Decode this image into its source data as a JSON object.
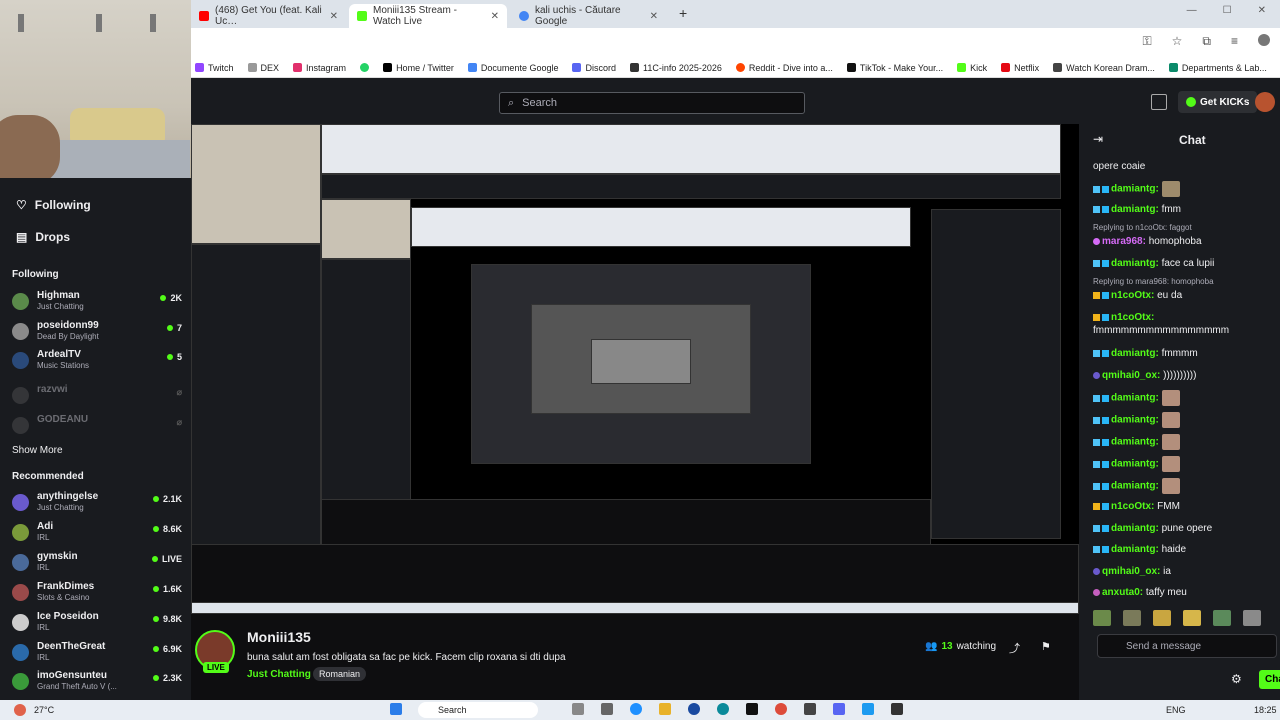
{
  "browser": {
    "tabs": [
      {
        "label": "(468) Get You (feat. Kali Uc…",
        "color": "#ff0000"
      },
      {
        "label": "Moniii135 Stream - Watch Live",
        "color": "#53fc18"
      },
      {
        "label": "kali uchis - Căutare Google",
        "color": "#4285f4"
      }
    ],
    "new_tab": "+",
    "bookmarks": [
      {
        "label": "Twitch",
        "color": "#9146ff"
      },
      {
        "label": "DEX",
        "color": "#999999"
      },
      {
        "label": "Instagram",
        "color": "#e1306c"
      },
      {
        "label": "",
        "color": "#25d366"
      },
      {
        "label": "Home / Twitter",
        "color": "#000000"
      },
      {
        "label": "Documente Google",
        "color": "#4285f4"
      },
      {
        "label": "Discord",
        "color": "#5865f2"
      },
      {
        "label": "11C-info 2025-2026",
        "color": "#333333"
      },
      {
        "label": "Reddit - Dive into a...",
        "color": "#ff4500"
      },
      {
        "label": "TikTok - Make Your...",
        "color": "#111111"
      },
      {
        "label": "Kick",
        "color": "#53fc18"
      },
      {
        "label": "Netflix",
        "color": "#e50914"
      },
      {
        "label": "Watch Korean Dram...",
        "color": "#444444"
      },
      {
        "label": "Departments & Lab...",
        "color": "#0b8a6a"
      }
    ]
  },
  "topnav": {
    "search_placeholder": "Search",
    "get_kicks": "Get KICKs"
  },
  "sidebar": {
    "following_nav": "Following",
    "drops_nav": "Drops",
    "following_header": "Following",
    "following": [
      {
        "name": "Highman",
        "category": "Just Chatting",
        "count": "2K",
        "live": true,
        "color": "#5a8a4a"
      },
      {
        "name": "poseidonn99",
        "category": "Dead By Daylight",
        "count": "7",
        "live": true,
        "color": "#8a8a8a"
      },
      {
        "name": "ArdealTV",
        "category": "Music Stations",
        "count": "5",
        "live": true,
        "color": "#2a4a7a"
      },
      {
        "name": "razvwi",
        "category": "",
        "count": "",
        "live": false,
        "color": "#666666"
      },
      {
        "name": "GODEANU",
        "category": "",
        "count": "",
        "live": false,
        "color": "#666666"
      }
    ],
    "show_more": "Show More",
    "recommended_header": "Recommended",
    "recommended": [
      {
        "name": "anythingelse",
        "category": "Just Chatting",
        "count": "2.1K",
        "color": "#6a5acd"
      },
      {
        "name": "Adi",
        "category": "IRL",
        "count": "8.6K",
        "color": "#7a9a3a"
      },
      {
        "name": "gymskin",
        "category": "IRL",
        "count": "LIVE",
        "color": "#4a6a9a"
      },
      {
        "name": "FrankDimes",
        "category": "Slots & Casino",
        "count": "1.6K",
        "color": "#9a4a4a"
      },
      {
        "name": "Ice Poseidon",
        "category": "IRL",
        "count": "9.8K",
        "color": "#cccccc"
      },
      {
        "name": "DeenTheGreat",
        "category": "IRL",
        "count": "6.9K",
        "color": "#2a6aaa"
      },
      {
        "name": "imoGensunteu",
        "category": "Grand Theft Auto V (...",
        "count": "2.3K",
        "color": "#3a9a3a"
      }
    ]
  },
  "stream": {
    "streamer": "Moniii135",
    "live_badge": "LIVE",
    "title": "buna salut am fost obligata sa fac pe kick. Facem clip roxana si dti dupa",
    "category": "Just Chatting",
    "tag": "Romanian",
    "viewers": "13",
    "viewers_label": "watching"
  },
  "chat": {
    "title": "Chat",
    "messages": [
      {
        "type": "text",
        "user": "",
        "text": "opere coaie",
        "color": "#efeff1"
      },
      {
        "type": "emote",
        "user": "damiantg:",
        "text": "",
        "color": "#53fc18"
      },
      {
        "type": "text",
        "user": "damiantg:",
        "text": "fmm",
        "color": "#53fc18"
      },
      {
        "type": "reply",
        "text": "Replying to n1coOtx: faggot"
      },
      {
        "type": "text",
        "user": "mara968:",
        "text": "homophoba",
        "color": "#d56bf6"
      },
      {
        "type": "text",
        "user": "damiantg:",
        "text": "face ca lupii",
        "color": "#53fc18"
      },
      {
        "type": "reply",
        "text": "Replying to mara968: homophoba"
      },
      {
        "type": "text",
        "user": "n1coOtx:",
        "text": "eu da",
        "color": "#53fc18"
      },
      {
        "type": "text",
        "user": "n1coOtx:",
        "text": "fmmmmmmmmmmmmmmmm",
        "color": "#53fc18"
      },
      {
        "type": "text",
        "user": "damiantg:",
        "text": "fmmmm",
        "color": "#53fc18"
      },
      {
        "type": "text",
        "user": "qmihai0_ox:",
        "text": "))))))))))",
        "color": "#53fc18"
      },
      {
        "type": "emote",
        "user": "damiantg:",
        "text": "",
        "color": "#53fc18"
      },
      {
        "type": "emote",
        "user": "damiantg:",
        "text": "",
        "color": "#53fc18"
      },
      {
        "type": "emote",
        "user": "damiantg:",
        "text": "",
        "color": "#53fc18"
      },
      {
        "type": "emote",
        "user": "damiantg:",
        "text": "",
        "color": "#53fc18"
      },
      {
        "type": "emote",
        "user": "damiantg:",
        "text": "",
        "color": "#53fc18"
      },
      {
        "type": "text",
        "user": "n1coOtx:",
        "text": "FMM",
        "color": "#53fc18"
      },
      {
        "type": "text",
        "user": "damiantg:",
        "text": "pune opere",
        "color": "#53fc18"
      },
      {
        "type": "text",
        "user": "damiantg:",
        "text": "haide",
        "color": "#53fc18"
      },
      {
        "type": "text",
        "user": "qmihai0_ox:",
        "text": "ia",
        "color": "#53fc18"
      },
      {
        "type": "text",
        "user": "anxuta0:",
        "text": "taffy meu",
        "color": "#53fc18"
      }
    ],
    "input_placeholder": "Send a message",
    "send_button": "Chat"
  },
  "taskbar": {
    "weather": "27°C",
    "search": "Search",
    "lang": "ENG",
    "time": "18:25"
  }
}
